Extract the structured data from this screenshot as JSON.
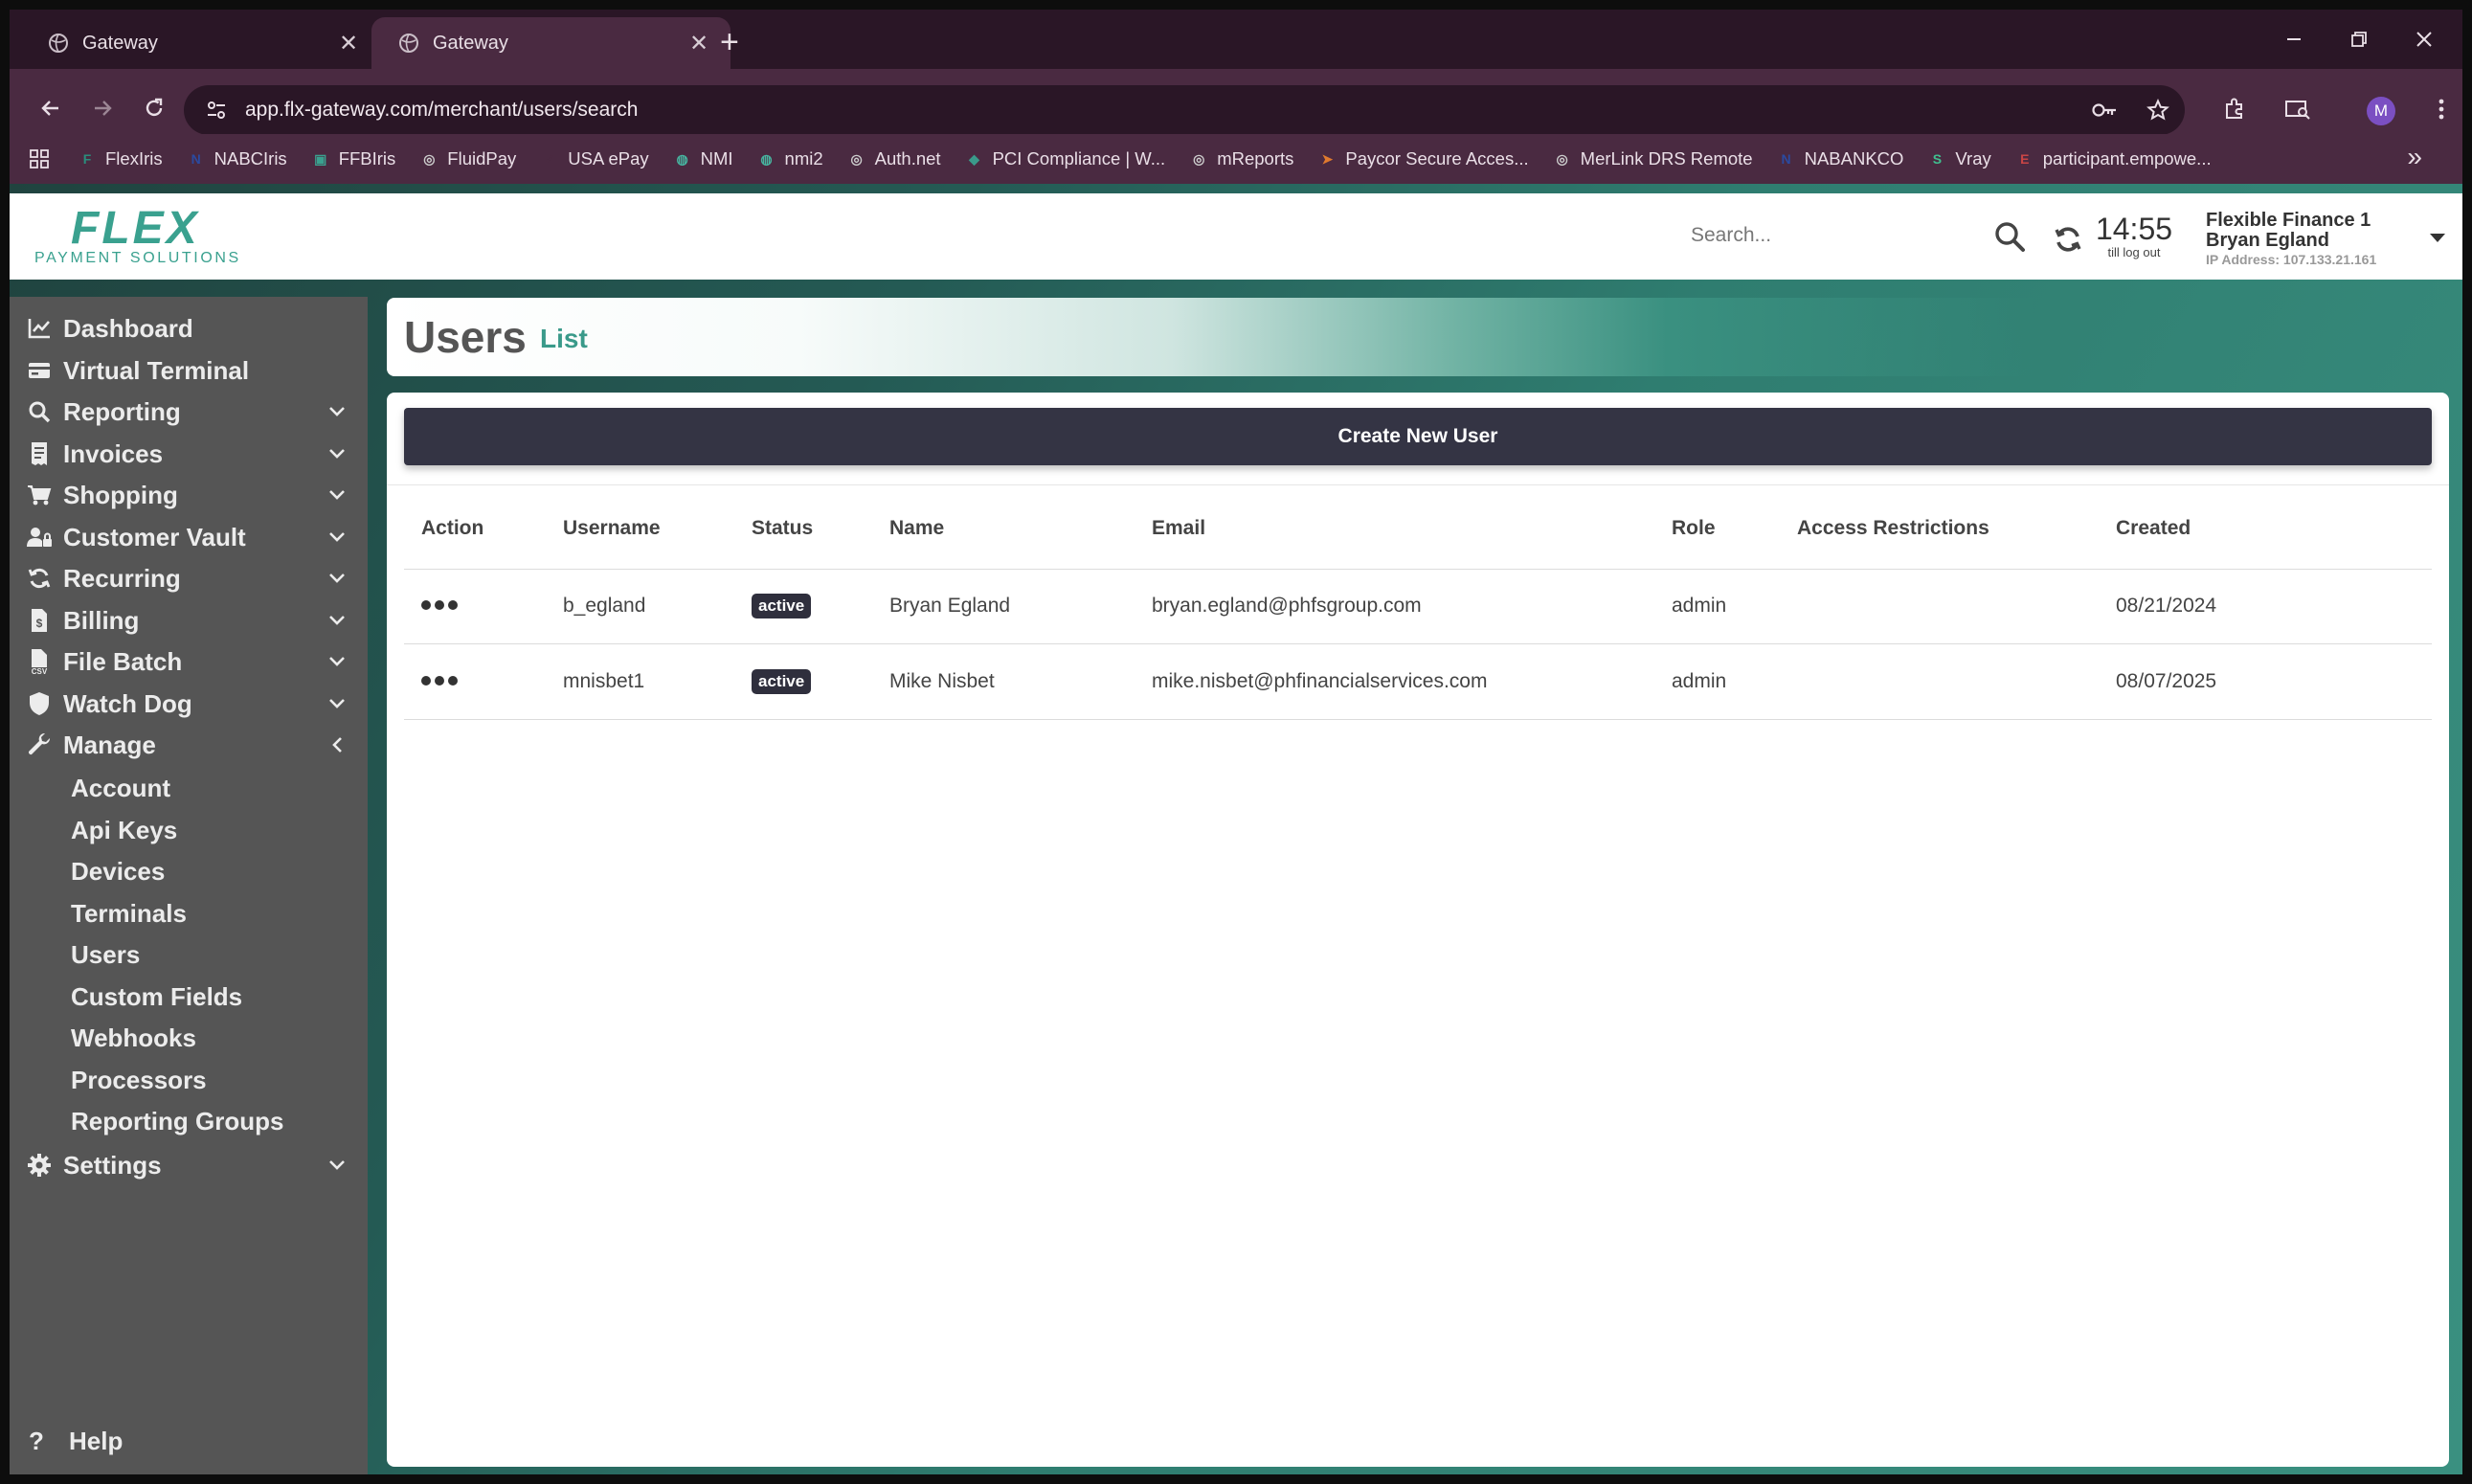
{
  "browser": {
    "tabs": [
      {
        "label": "Gateway",
        "active": false
      },
      {
        "label": "Gateway",
        "active": true
      }
    ],
    "url": "app.flx-gateway.com/merchant/users/search",
    "profile_initial": "M",
    "bookmarks": [
      {
        "label": "FlexIris",
        "icon": "F",
        "color": "#2a8d7c"
      },
      {
        "label": "NABCIris",
        "icon": "N",
        "color": "#2b4aa0"
      },
      {
        "label": "FFBIris",
        "icon": "▣",
        "color": "#3aa18f"
      },
      {
        "label": "FluidPay",
        "icon": "◎",
        "color": "#cccccc"
      },
      {
        "label": "USA ePay",
        "icon": "✓",
        "color": "#4a2a41"
      },
      {
        "label": "NMI",
        "icon": "◍",
        "color": "#47b39f"
      },
      {
        "label": "nmi2",
        "icon": "◍",
        "color": "#47b39f"
      },
      {
        "label": "Auth.net",
        "icon": "◎",
        "color": "#cccccc"
      },
      {
        "label": "PCI Compliance | W...",
        "icon": "◆",
        "color": "#3a9a8a"
      },
      {
        "label": "mReports",
        "icon": "◎",
        "color": "#cccccc"
      },
      {
        "label": "Paycor Secure Acces...",
        "icon": "➤",
        "color": "#e07a2e"
      },
      {
        "label": "MerLink DRS Remote",
        "icon": "◎",
        "color": "#cccccc"
      },
      {
        "label": "NABANKCO",
        "icon": "N",
        "color": "#2b4aa0"
      },
      {
        "label": "Vray",
        "icon": "S",
        "color": "#3fbf8f"
      },
      {
        "label": "participant.empowe...",
        "icon": "E",
        "color": "#c94545"
      }
    ]
  },
  "app": {
    "logo_text": "FLEX",
    "logo_subtext": "PAYMENT SOLUTIONS",
    "search_placeholder": "Search...",
    "timer": "14:55",
    "timer_label": "till log out",
    "account_line1": "Flexible Finance 1",
    "account_line2": "Bryan Egland",
    "ip_address": "IP Address: 107.133.21.161"
  },
  "sidebar": {
    "items": [
      {
        "label": "Dashboard",
        "icon": "chart-line-icon",
        "chevron": "none"
      },
      {
        "label": "Virtual Terminal",
        "icon": "credit-card-icon",
        "chevron": "none"
      },
      {
        "label": "Reporting",
        "icon": "search-icon",
        "chevron": "down"
      },
      {
        "label": "Invoices",
        "icon": "receipt-icon",
        "chevron": "down"
      },
      {
        "label": "Shopping",
        "icon": "cart-icon",
        "chevron": "down"
      },
      {
        "label": "Customer Vault",
        "icon": "user-lock-icon",
        "chevron": "down"
      },
      {
        "label": "Recurring",
        "icon": "sync-icon",
        "chevron": "down"
      },
      {
        "label": "Billing",
        "icon": "invoice-dollar-icon",
        "chevron": "down"
      },
      {
        "label": "File Batch",
        "icon": "file-csv-icon",
        "chevron": "down"
      },
      {
        "label": "Watch Dog",
        "icon": "shield-icon",
        "chevron": "down"
      },
      {
        "label": "Manage",
        "icon": "wrench-icon",
        "chevron": "left"
      }
    ],
    "manage_subitems": [
      "Account",
      "Api Keys",
      "Devices",
      "Terminals",
      "Users",
      "Custom Fields",
      "Webhooks",
      "Processors",
      "Reporting Groups"
    ],
    "settings": {
      "label": "Settings",
      "icon": "gear-icon",
      "chevron": "down"
    },
    "help": "Help"
  },
  "main": {
    "title": "Users",
    "subtitle": "List",
    "create_button": "Create New User",
    "columns": [
      "Action",
      "Username",
      "Status",
      "Name",
      "Email",
      "Role",
      "Access Restrictions",
      "Created"
    ],
    "rows": [
      {
        "username": "b_egland",
        "status": "active",
        "name": "Bryan Egland",
        "email": "bryan.egland@phfsgroup.com",
        "role": "admin",
        "access_restrictions": "",
        "created": "08/21/2024"
      },
      {
        "username": "mnisbet1",
        "status": "active",
        "name": "Mike Nisbet",
        "email": "mike.nisbet@phfinancialservices.com",
        "role": "admin",
        "access_restrictions": "",
        "created": "08/07/2025"
      }
    ]
  }
}
